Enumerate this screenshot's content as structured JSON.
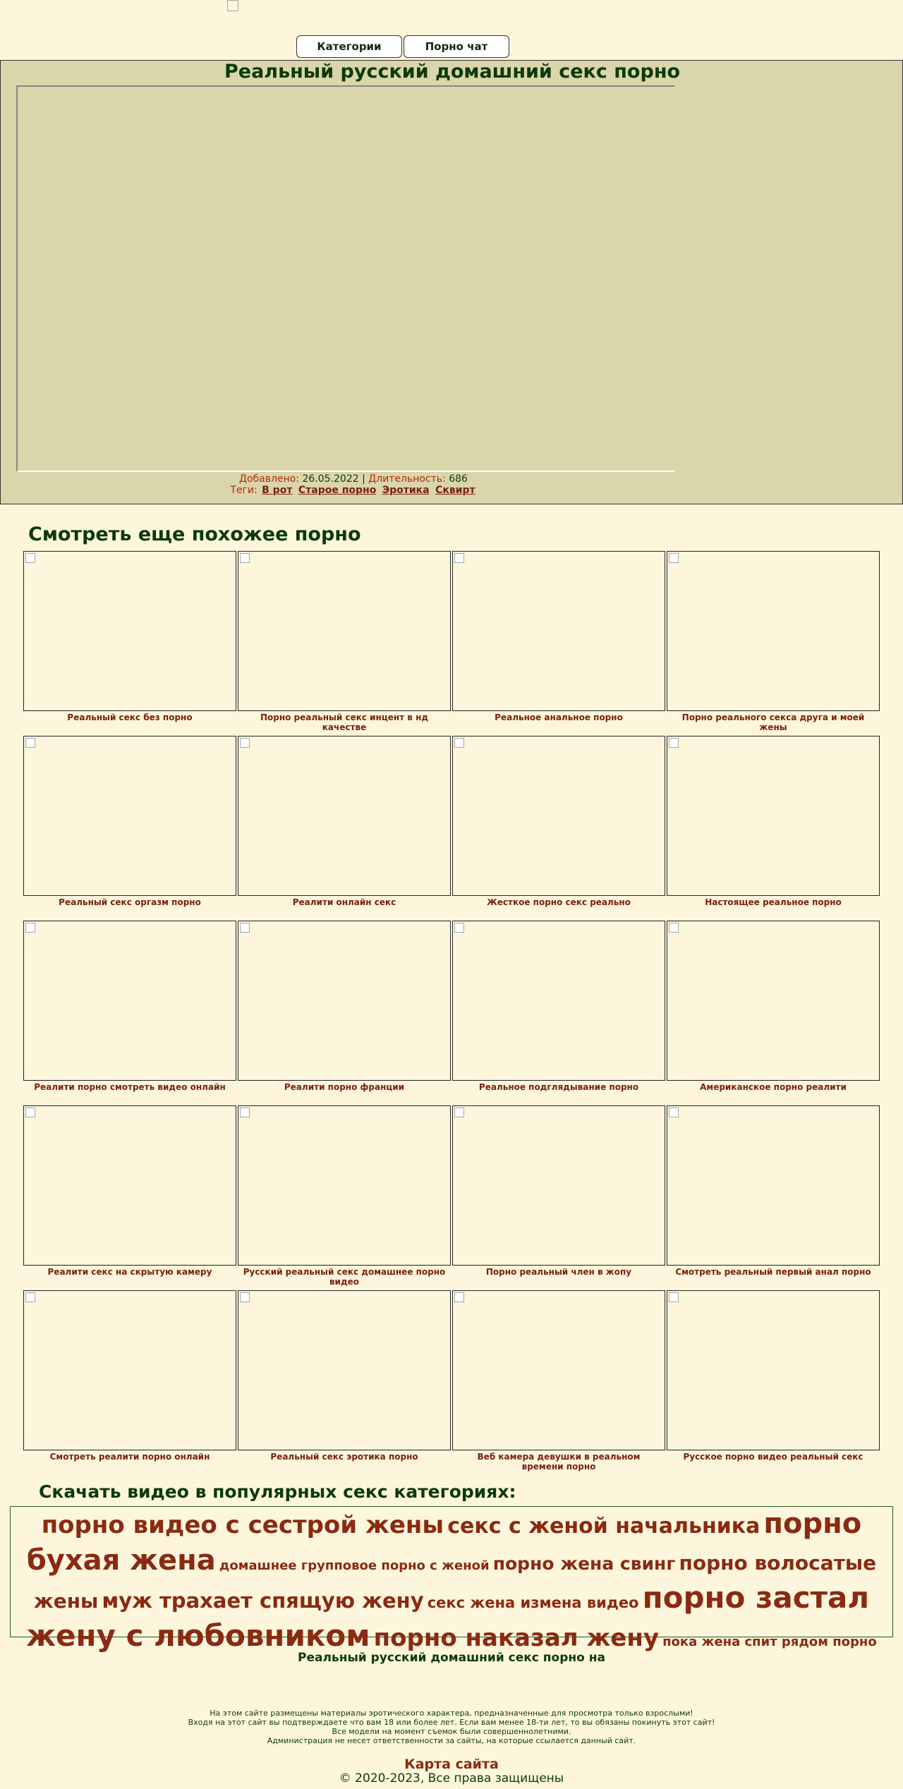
{
  "header": {
    "logo_icon": "broken-image-icon"
  },
  "nav": {
    "categories": "Категории",
    "chat": "Порно чат"
  },
  "video": {
    "title": "Реальный русский домашний секс порно",
    "added_label": "Добавлено:",
    "added_value": "26.05.2022",
    "separator": "|",
    "duration_label": "Длительность:",
    "duration_value": "686",
    "tags_label": "Теги:",
    "tags": [
      "В рот",
      "Старое порно",
      "Эротика",
      "Сквирт"
    ]
  },
  "related": {
    "heading": "Смотреть еще похожее порно",
    "items": [
      "Реальный секс без порно",
      "Порно реальный секс инцент в нд качестве",
      "Реальное анальное порно",
      "Порно реального секса друга и моей жены",
      "Реальный секс оргазм порно",
      "Реалити онлайн секс",
      "Жесткое порно секс реально",
      "Настоящее реальное порно",
      "Реалити порно смотреть видео онлайн",
      "Реалити порно франции",
      "Реальное подглядывание порно",
      "Американское порно реалити",
      "Реалити секс на скрытую камеру",
      "Русский реальный секс домашнее порно видео",
      "Порно реальный член в жопу",
      "Смотреть реальный первый анал порно",
      "Смотреть реалити порно онлайн",
      "Реальный секс эротика порно",
      "Веб камера девушки в реальном времени порно",
      "Русское порно видео реальный секс"
    ]
  },
  "categories": {
    "heading": "Скачать видео в популярных секс категориях:",
    "tags": [
      {
        "text": "порно видео с сестрой жены",
        "size": 34
      },
      {
        "text": "секс с женой начальника",
        "size": 30
      },
      {
        "text": "порно бухая жена",
        "size": 40
      },
      {
        "text": "домашнее групповое порно с женой",
        "size": 18
      },
      {
        "text": "порно жена свинг",
        "size": 25
      },
      {
        "text": "порно волосатые жены",
        "size": 28
      },
      {
        "text": "муж трахает спящую жену",
        "size": 29
      },
      {
        "text": "секс жена измена видео",
        "size": 21
      },
      {
        "text": "порно застал жену с любовником",
        "size": 42
      },
      {
        "text": "порно наказал жену",
        "size": 34
      },
      {
        "text": "пока жена спит рядом порно",
        "size": 18
      }
    ]
  },
  "footer": {
    "title": "Реальный русский домашний секс порно на",
    "disclaimer": [
      "На этом сайте размещены материалы эротического характера, предназначенные для просмотра только взрослыми!",
      "Входя на этот сайт вы подтверждаете что вам 18 или более лет. Если вам менее 18-ти лет, то вы обязаны покинуть этот сайт!",
      "Все модели на момент съемок были совершеннолетними.",
      "Администрация не несет ответственности за сайты, на которые ссылается данный сайт."
    ],
    "sitemap": "Карта сайта",
    "copyright": "© 2020-2023, Все права защищены"
  }
}
